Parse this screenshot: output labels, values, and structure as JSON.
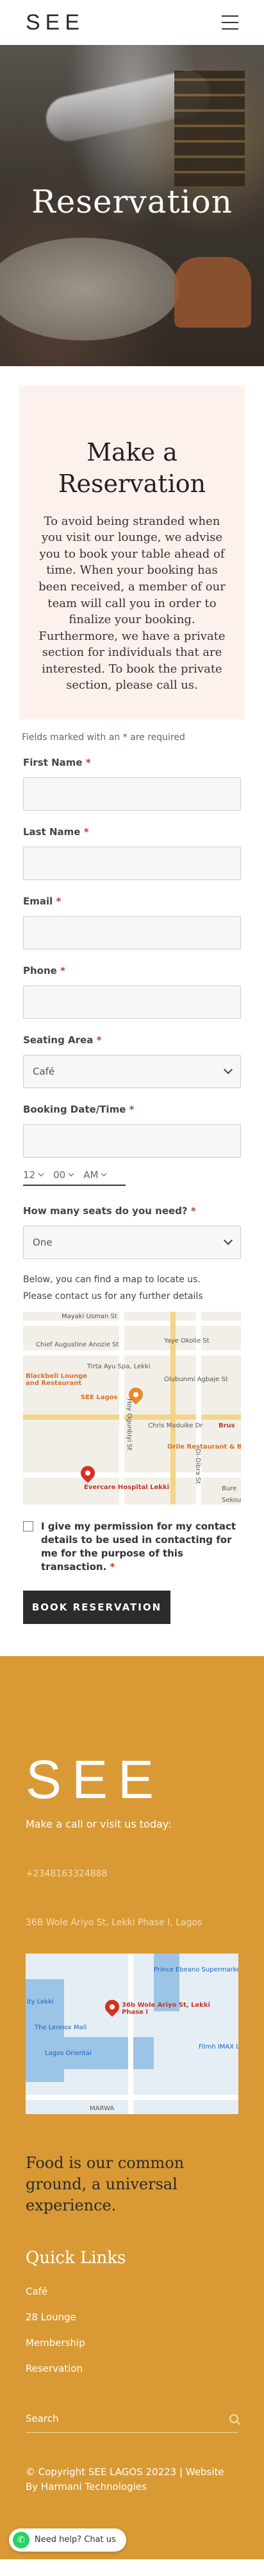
{
  "header": {
    "logo": "SEE"
  },
  "hero": {
    "title": "Reservation"
  },
  "form": {
    "heading": "Make a Reservation",
    "intro": "To avoid being stranded when you visit our lounge, we advise you to book your table ahead of time. When your booking has been received, a member of our team will call you in order to finalize your booking. Furthermore, we have a private section for individuals that are interested. To book the private section, please call us.",
    "required_note": "Fields marked with an",
    "required_note_end": "are required",
    "first_name_label": "First Name",
    "last_name_label": "Last Name",
    "email_label": "Email",
    "phone_label": "Phone",
    "seating_label": "Seating Area",
    "seating_value": "Café",
    "booking_label": "Booking Date/Time",
    "time_hour": "12",
    "time_minute": "00",
    "time_ampm": "AM",
    "seats_label": "How many seats do you need?",
    "seats_value": "One",
    "map_info": "Below, you can find a map to locate us.",
    "contact_info": "Please contact us for any further details",
    "map_labels": {
      "mayaki": "Mayaki Usman St",
      "chief": "Chief Augustine Anozie St",
      "yaye": "Yaye Okolie St",
      "tirta": "Tirta Ayu Spa, Lekki",
      "olubunmi": "Olubunmi Agbaje St",
      "blackbell": "Blackbell Lounge and Restaurant",
      "see": "SEE Lagos",
      "hoy": "Hoy Ogunbiyi St",
      "chris": "Chris Maduike Dr",
      "brus": "Brus",
      "orile": "Orile Restaurant & Bar",
      "evercare": "Evercare Hospital Lekki",
      "bure": "Bure",
      "sekou": "Sekou",
      "didbra": "Di-Dibra St"
    },
    "consent": "I give my permission for my contact details to be used in contacting for me for the purpose of this transaction.",
    "submit": "BOOK RESERVATION"
  },
  "footer": {
    "logo": "SEE",
    "tagline_top": "Make a call or visit us today:",
    "phone": "+2348163324888",
    "address": "36B Wole Ariyo St, Lekki Phase I, Lagos",
    "map_labels": {
      "prince": "Prince Ebeano Supermarket",
      "lekki": "ity Lekki",
      "address_pin": "36b Wole Ariyo St, Lekki Phase I",
      "lennox": "The Lennox Mall",
      "lagos": "Lagos Oriental",
      "filmhouse": "Filmh IMAX Le",
      "marwa": "MARWA"
    },
    "slogan": "Food is our common ground, a universal experience.",
    "quick_links_title": "Quick Links",
    "links": [
      "Café",
      "28 Lounge",
      "Membership",
      "Reservation"
    ],
    "search_placeholder": "Search",
    "copyright": "© Copyright SEE LAGOS 20223 | Website By Harmani Technologies",
    "whatsapp": "Need help? Chat us"
  }
}
